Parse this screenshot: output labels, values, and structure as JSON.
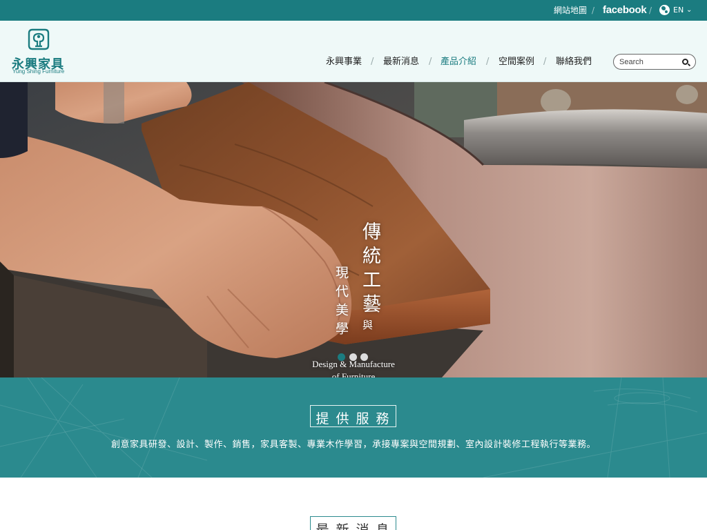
{
  "topbar": {
    "sitemap": "網站地圖",
    "facebook": "facebook",
    "language": "EN",
    "separator": "/"
  },
  "logo": {
    "name_zh": "永興家具",
    "name_en": "Yung Shing Furniture"
  },
  "nav": {
    "items": [
      {
        "label": "永興事業"
      },
      {
        "label": "最新消息"
      },
      {
        "label": "產品介紹",
        "active": true
      },
      {
        "label": "空間案例"
      },
      {
        "label": "聯絡我們"
      }
    ],
    "separator": "/"
  },
  "search": {
    "placeholder": "Search"
  },
  "hero": {
    "headline": "傳統工藝",
    "connector": "與",
    "subheadline": "現代美學",
    "english_line1": "Design & Manufacture",
    "english_line2": "of Furniture",
    "slides": 3,
    "active_slide": 1
  },
  "services": {
    "title": "提供服務",
    "description": "創意家具研發、設計、製作、銷售，家具客製、專業木作學習，承接專案與空間規劃、室內設計裝修工程執行等業務。"
  },
  "news": {
    "title": "最新消息"
  },
  "colors": {
    "brand_teal": "#1b7c80",
    "band_teal": "#2b8a8e"
  }
}
